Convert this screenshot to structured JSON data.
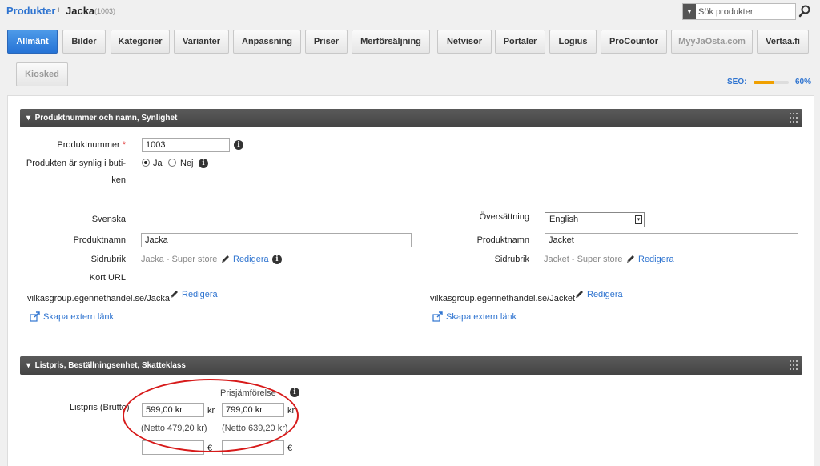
{
  "breadcrumb": {
    "root": "Produkter",
    "separator": "+",
    "current": "Jacka",
    "id": "(1003)"
  },
  "search": {
    "placeholder": "Sök produkter",
    "icon": "search-icon"
  },
  "tabs": [
    {
      "label": "Allmänt",
      "active": true
    },
    {
      "label": "Bilder"
    },
    {
      "label": "Kategorier"
    },
    {
      "label": "Varianter"
    },
    {
      "label": "Anpassning"
    },
    {
      "label": "Priser"
    },
    {
      "label": "Merförsäljning"
    },
    {
      "label": "Netvisor"
    },
    {
      "label": "Portaler"
    },
    {
      "label": "Logius"
    },
    {
      "label": "ProCountor"
    },
    {
      "label": "MyyJaOsta.com",
      "muted": true
    },
    {
      "label": "Vertaa.fi"
    },
    {
      "label": "Kiosked",
      "muted": true
    }
  ],
  "seo": {
    "label": "SEO:",
    "value": "60%",
    "fraction": 0.6,
    "color": "#f0a000"
  },
  "section1": {
    "title": "Produktnummer och namn, Synlighet",
    "product_number_label": "Produktnummer",
    "required_mark": "*",
    "product_number": "1003",
    "visible_label_line1": "Produkten är synlig i buti-",
    "visible_label_line2": "ken",
    "radio_yes": "Ja",
    "radio_no": "Nej",
    "left": {
      "language": "Svenska",
      "name_label": "Produktnamn",
      "name": "Jacka",
      "subheading_label": "Sidrubrik",
      "subheading": "Jacka - Super store",
      "edit": "Redigera",
      "short_url_label": "Kort URL",
      "url": "vilkasgroup.egennethandel.se/Jacka",
      "create_link": "Skapa extern länk"
    },
    "right": {
      "translation_label": "Översättning",
      "translation_value": "English",
      "name_label": "Produktnamn",
      "name": "Jacket",
      "subheading_label": "Sidrubrik",
      "subheading": "Jacket - Super store",
      "edit": "Redigera",
      "url": "vilkasgroup.egennethandel.se/Jacket",
      "create_link": "Skapa extern länk"
    }
  },
  "section2": {
    "title": "Listpris, Beställningsenhet, Skatteklass",
    "price_label": "Listpris (Brutto)",
    "comparison_label": "Prisjämförelse",
    "price": "599,00 kr",
    "comparison_price": "799,00 kr",
    "currency_suffix": "kr",
    "net_price": "(Netto 479,20 kr)",
    "net_comparison": "(Netto 639,20 kr)",
    "euro_suffix": "€"
  },
  "colors": {
    "accent": "#2f74d0",
    "header_bar": "#4a4a4a",
    "highlight": "#d71a1a"
  }
}
